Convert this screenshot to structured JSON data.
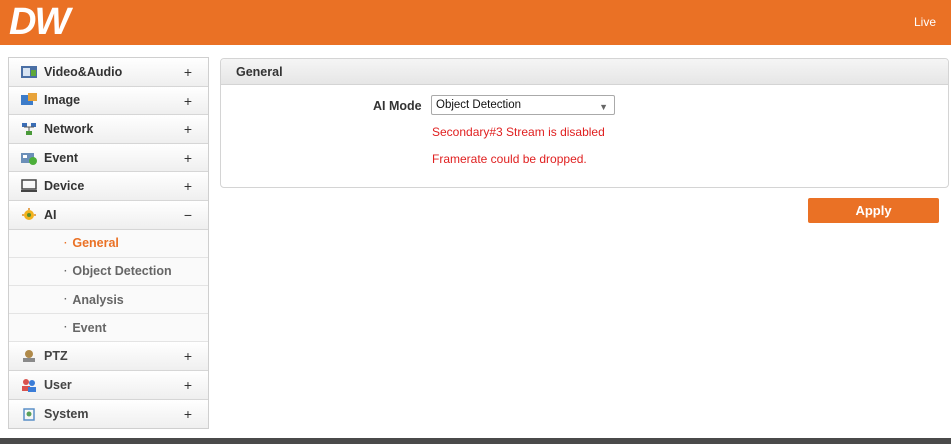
{
  "header": {
    "logo": "DW",
    "live_label": "Live"
  },
  "sidebar": {
    "items": [
      {
        "label": "Video&Audio",
        "sign": "+"
      },
      {
        "label": "Image",
        "sign": "+"
      },
      {
        "label": "Network",
        "sign": "+"
      },
      {
        "label": "Event",
        "sign": "+"
      },
      {
        "label": "Device",
        "sign": "+"
      },
      {
        "label": "AI",
        "sign": "−"
      },
      {
        "label": "PTZ",
        "sign": "+"
      },
      {
        "label": "User",
        "sign": "+"
      },
      {
        "label": "System",
        "sign": "+"
      }
    ],
    "ai_subitems": [
      {
        "label": "General"
      },
      {
        "label": "Object Detection"
      },
      {
        "label": "Analysis"
      },
      {
        "label": "Event"
      }
    ],
    "bullet": "·"
  },
  "panel": {
    "title": "General",
    "ai_mode_label": "AI Mode",
    "ai_mode_value": "Object Detection",
    "warning_1": "Secondary#3 Stream is disabled",
    "warning_2": "Framerate could be dropped."
  },
  "apply_label": "Apply",
  "colors": {
    "accent": "#ea7125",
    "warning": "#e02020"
  }
}
